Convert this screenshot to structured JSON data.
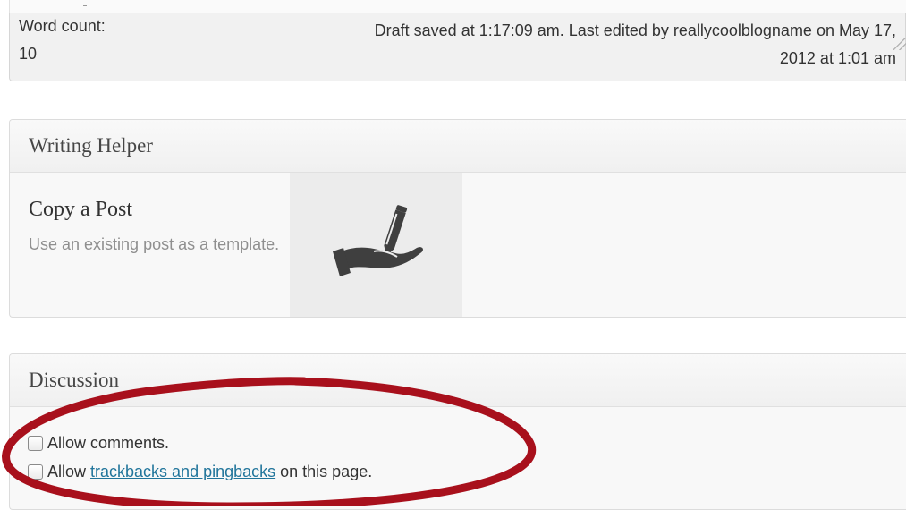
{
  "status_bar": {
    "word_count_label": "Word count:",
    "word_count_value": "10",
    "draft_line1": "Draft saved at 1:17:09 am. Last edited by reallycoolblogname on May 17,",
    "draft_line2": "2012 at 1:01 am"
  },
  "writing_helper": {
    "title": "Writing Helper",
    "copy_post": {
      "title": "Copy a Post",
      "description": "Use an existing post as a template.",
      "icon": "hand-with-pen-icon"
    }
  },
  "discussion": {
    "title": "Discussion",
    "allow_comments_label": "Allow comments.",
    "allow_comments_checked": false,
    "trackbacks_prefix": "Allow",
    "trackbacks_link": "trackbacks and pingbacks",
    "trackbacks_suffix": "on this page.",
    "allow_trackbacks_checked": false
  },
  "colors": {
    "link": "#21759b",
    "annotation": "#a8101c"
  }
}
